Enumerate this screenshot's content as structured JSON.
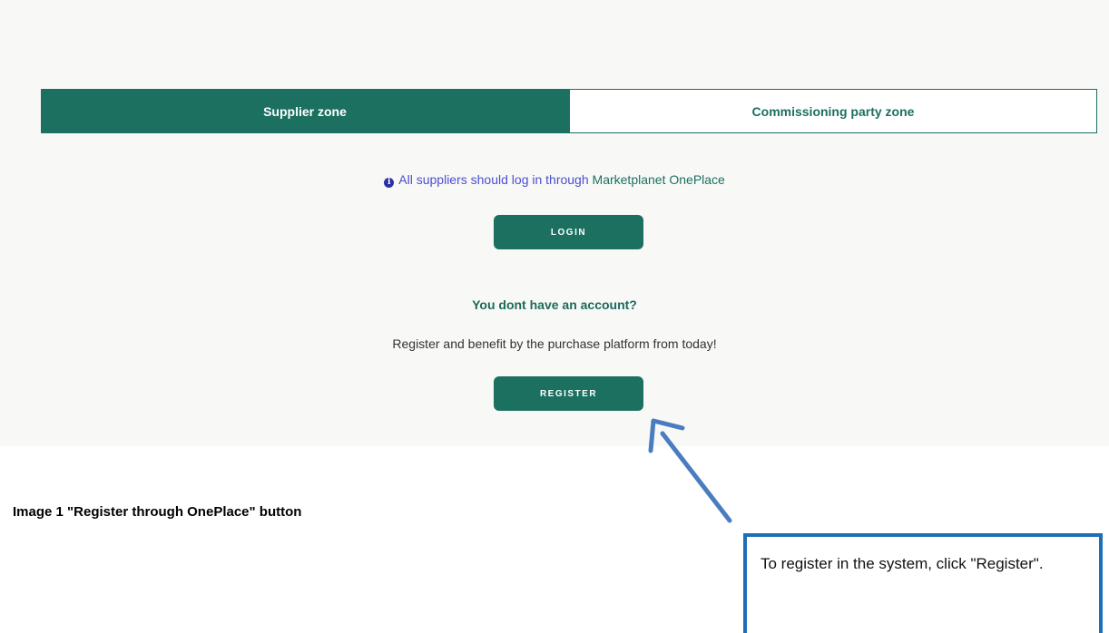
{
  "tabs": {
    "supplier": "Supplier zone",
    "commissioning": "Commissioning party zone"
  },
  "info": {
    "text": "All suppliers should log in through",
    "link": "Marketplanet OnePlace",
    "icon": "info-icon"
  },
  "buttons": {
    "login": "LOGIN",
    "register": "REGISTER"
  },
  "account": {
    "heading": "You dont have an account?",
    "text": "Register and benefit by the purchase platform from today!"
  },
  "caption": "Image 1 \"Register through OnePlace\" button",
  "callout": {
    "text": "To register in the system, click \"Register\"."
  },
  "colors": {
    "primary": "#1b7060",
    "info": "#4a4fd0",
    "callout_border": "#1e6fb8",
    "arrow": "#4a7cc0"
  }
}
